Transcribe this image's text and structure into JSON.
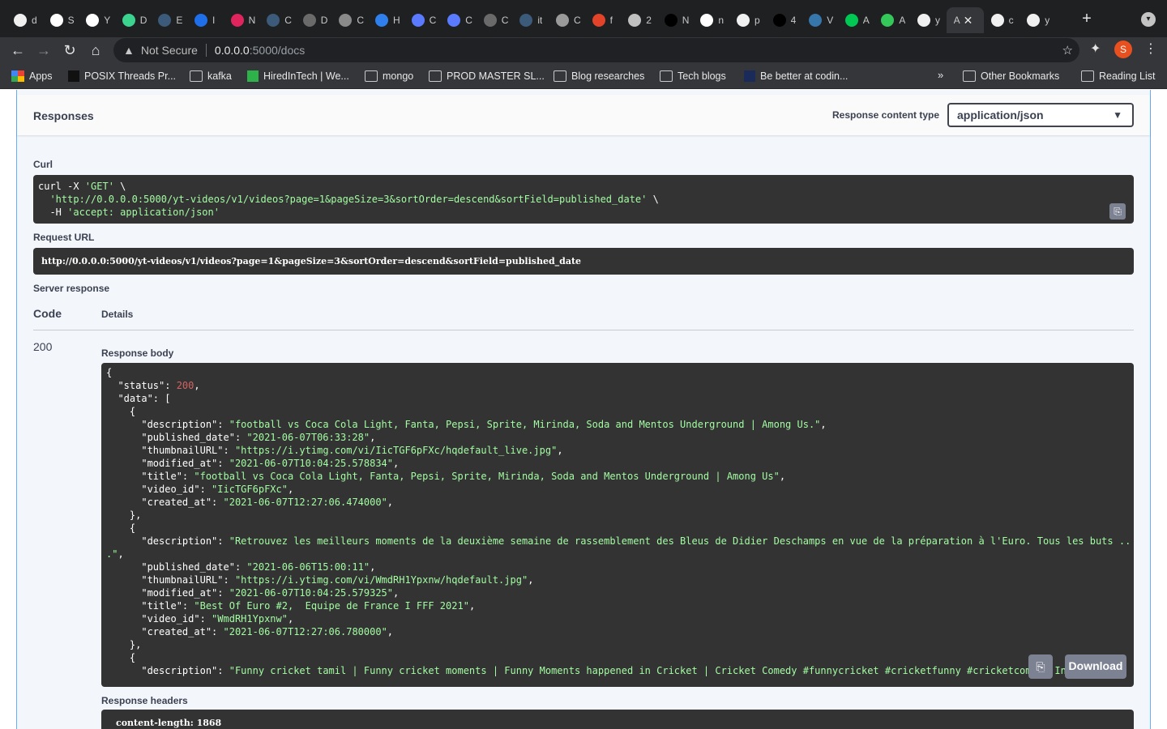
{
  "browser": {
    "tabs": [
      {
        "letter": "d",
        "color": "#f0f0f0"
      },
      {
        "letter": "S",
        "color": "#ffffff"
      },
      {
        "letter": "Y",
        "color": "#ffffff"
      },
      {
        "letter": "D",
        "color": "#3bd48f"
      },
      {
        "letter": "E",
        "color": "#3c5a7a"
      },
      {
        "letter": "I",
        "color": "#1f6feb"
      },
      {
        "letter": "N",
        "color": "#e0245e"
      },
      {
        "letter": "C",
        "color": "#3c5a7a"
      },
      {
        "letter": "D",
        "color": "#6a6a6a"
      },
      {
        "letter": "C",
        "color": "#8a8a8a"
      },
      {
        "letter": "H",
        "color": "#2f80ed"
      },
      {
        "letter": "C",
        "color": "#5a7bff"
      },
      {
        "letter": "C",
        "color": "#5a7bff"
      },
      {
        "letter": "C",
        "color": "#6a6a6a"
      },
      {
        "letter": "it",
        "color": "#3c5a7a"
      },
      {
        "letter": "C",
        "color": "#9a9a9a"
      },
      {
        "letter": "f",
        "color": "#e24329"
      },
      {
        "letter": "2",
        "color": "#c0c0c0"
      },
      {
        "letter": "N",
        "color": "#000000"
      },
      {
        "letter": "n",
        "color": "#ffffff"
      },
      {
        "letter": "p",
        "color": "#f0f0f0"
      },
      {
        "letter": "4",
        "color": "#000000"
      },
      {
        "letter": "V",
        "color": "#3776ab"
      },
      {
        "letter": "A",
        "color": "#00c853"
      },
      {
        "letter": "A",
        "color": "#34c759"
      },
      {
        "letter": "y",
        "color": "#f0f0f0"
      },
      {
        "letter": "A",
        "color": "",
        "active": true
      },
      {
        "letter": "c",
        "color": "#f0f0f0"
      },
      {
        "letter": "y",
        "color": "#f0f0f0"
      }
    ],
    "active_tab_letter": "A",
    "active_tab_close": "✕",
    "new_tab": "+",
    "address": {
      "security_label": "Not Secure",
      "host": "0.0.0.0",
      "path": ":5000/docs"
    },
    "bookmarks": [
      {
        "label": "Apps",
        "icon": "apps-grid-icon"
      },
      {
        "label": "POSIX Threads Pr...",
        "icon": "bookmark-favicon"
      },
      {
        "label": "kafka",
        "icon": "folder-icon"
      },
      {
        "label": "HiredInTech | We...",
        "icon": "bookmark-favicon"
      },
      {
        "label": "mongo",
        "icon": "folder-icon"
      },
      {
        "label": "PROD MASTER SL...",
        "icon": "folder-icon"
      },
      {
        "label": "Blog researches",
        "icon": "folder-icon"
      },
      {
        "label": "Tech blogs",
        "icon": "folder-icon"
      },
      {
        "label": "Be better at codin...",
        "icon": "bookmark-favicon"
      }
    ],
    "bookmarks_overflow": "»",
    "other_bookmarks": "Other Bookmarks",
    "reading_list": "Reading List",
    "profile_initial": "S"
  },
  "responses": {
    "title": "Responses",
    "content_type_label": "Response content type",
    "content_type_value": "application/json",
    "curl_label": "Curl",
    "curl_lines": [
      {
        "plain": "curl -X ",
        "str": "'GET'",
        "tail": " \\"
      },
      {
        "plain": "  ",
        "str": "'http://0.0.0.0:5000/yt-videos/v1/videos?page=1&pageSize=3&sortOrder=descend&sortField=published_date'",
        "tail": " \\"
      },
      {
        "plain": "  -H ",
        "str": "'accept: application/json'",
        "tail": ""
      }
    ],
    "request_url_label": "Request URL",
    "request_url": "http://0.0.0.0:5000/yt-videos/v1/videos?page=1&pageSize=3&sortOrder=descend&sortField=published_date",
    "server_response_label": "Server response",
    "code_header": "Code",
    "details_header": "Details",
    "code": "200",
    "response_body_label": "Response body",
    "body": {
      "status": 200,
      "items": [
        {
          "description": "football vs Coca Cola Light, Fanta, Pepsi, Sprite, Mirinda, Soda and Mentos Underground | Among Us.",
          "published_date": "2021-06-07T06:33:28",
          "thumbnailURL": "https://i.ytimg.com/vi/IicTGF6pFXc/hqdefault_live.jpg",
          "modified_at": "2021-06-07T10:04:25.578834",
          "title": "football vs Coca Cola Light, Fanta, Pepsi, Sprite, Mirinda, Soda and Mentos Underground | Among Us",
          "video_id": "IicTGF6pFXc",
          "created_at": "2021-06-07T12:27:06.474000"
        },
        {
          "description": "Retrouvez les meilleurs moments de la deuxième semaine de rassemblement des Bleus de Didier Deschamps en vue de la préparation à l'Euro. Tous les buts ...",
          "published_date": "2021-06-06T15:00:11",
          "thumbnailURL": "https://i.ytimg.com/vi/WmdRH1Ypxnw/hqdefault.jpg",
          "modified_at": "2021-06-07T10:04:25.579325",
          "title": "Best Of Euro #2,  Equipe de France I FFF 2021",
          "video_id": "WmdRH1Ypxnw",
          "created_at": "2021-06-07T12:27:06.780000"
        },
        {
          "description": "Funny cricket tamil | Funny cricket moments | Funny Moments happened in Cricket | Cricket Comedy #funnycricket #cricketfunny #cricketcomedy In we ..."
        }
      ]
    },
    "download_label": "Download",
    "response_headers_label": "Response headers",
    "content_length": "content-length: 1868"
  },
  "colors": {
    "string": "#a2fca2",
    "number": "#d36363",
    "code_bg": "#333333",
    "accent": "#61affe"
  }
}
